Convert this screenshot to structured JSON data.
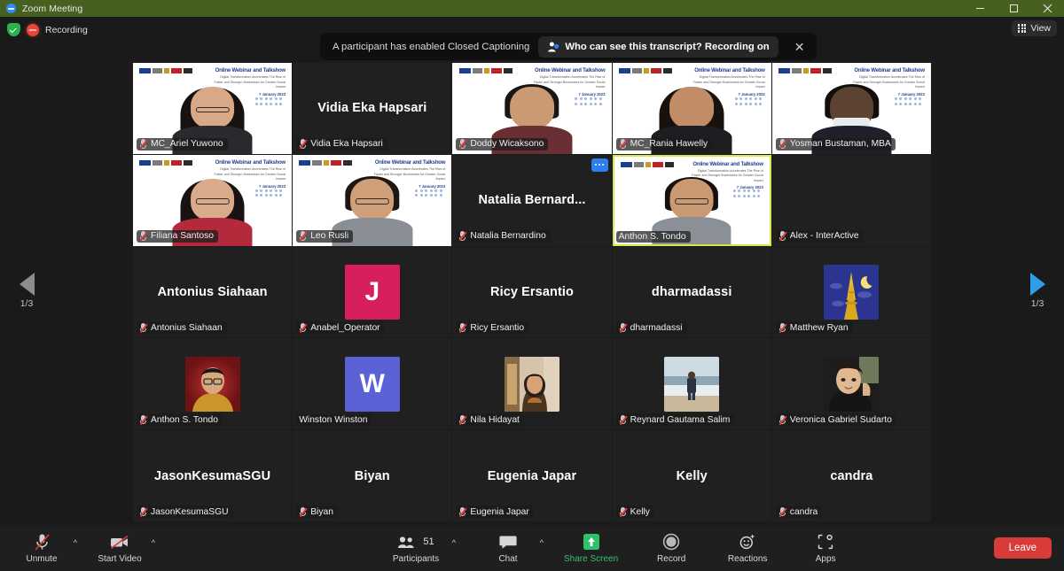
{
  "window": {
    "title": "Zoom Meeting",
    "minimize_label": "minimize",
    "maximize_label": "maximize",
    "close_label": "close"
  },
  "topbar": {
    "recording_label": "Recording",
    "view_label": "View"
  },
  "notification": {
    "message": "A participant has enabled Closed Captioning",
    "action": "Who can see this transcript? Recording on",
    "close": "✕"
  },
  "pagination": {
    "left_page": "1/3",
    "right_page": "1/3"
  },
  "participants": [
    {
      "label": "MC_Ariel Yuwono",
      "display": "",
      "muted": true,
      "kind": "video",
      "skin": "#d8a887",
      "hair": "#17120f",
      "shirt": "#2a2a2e",
      "hairstyle": "long",
      "glasses": true
    },
    {
      "label": "Vidia Eka Hapsari",
      "display": "Vidia Eka Hapsari",
      "muted": true,
      "kind": "name"
    },
    {
      "label": "Doddy Wicaksono",
      "display": "",
      "muted": true,
      "kind": "video",
      "skin": "#c99a73",
      "hair": "#1b1613",
      "shirt": "#6a2f33",
      "hairstyle": "short",
      "glasses": false
    },
    {
      "label": "MC_Rania Hawelly",
      "display": "",
      "muted": true,
      "kind": "video",
      "skin": "#c08d66",
      "hair": "#18120e",
      "shirt": "#1d1d22",
      "hairstyle": "long",
      "glasses": false
    },
    {
      "label": "Yosman Bustaman, MBA",
      "display": "",
      "muted": true,
      "kind": "video",
      "skin": "#5c4231",
      "hair": "#120e0b",
      "shirt": "#20202a",
      "hairstyle": "short",
      "glasses": false,
      "mask": true
    },
    {
      "label": "Filiana Santoso",
      "display": "",
      "muted": true,
      "kind": "video",
      "skin": "#d9ab8a",
      "hair": "#181211",
      "shirt": "#b32a3c",
      "hairstyle": "long",
      "glasses": true
    },
    {
      "label": "Leo Rusli",
      "display": "",
      "muted": true,
      "kind": "video",
      "skin": "#cf9f79",
      "hair": "#1d1714",
      "shirt": "#8a8f96",
      "hairstyle": "short",
      "glasses": true
    },
    {
      "label": "Natalia Bernardino",
      "display": "Natalia  Bernard...",
      "muted": true,
      "kind": "name",
      "more": true
    },
    {
      "label": "Anthon S. Tondo",
      "display": "",
      "muted": false,
      "kind": "video",
      "active": true,
      "skin": "#c99a72",
      "hair": "#151010",
      "shirt": "#8a8f98",
      "hairstyle": "short",
      "glasses": true
    },
    {
      "label": "Alex - InterActive",
      "display": "",
      "muted": true,
      "kind": "blank"
    },
    {
      "label": "Antonius Siahaan",
      "display": "Antonius Siahaan",
      "muted": true,
      "kind": "name"
    },
    {
      "label": "Anabel_Operator",
      "display": "",
      "muted": true,
      "kind": "initial",
      "initial": "J",
      "color": "#d61f5c"
    },
    {
      "label": "Ricy Ersantio",
      "display": "Ricy Ersantio",
      "muted": true,
      "kind": "name"
    },
    {
      "label": "dharmadassi",
      "display": "dharmadassi",
      "muted": true,
      "kind": "name"
    },
    {
      "label": "Matthew Ryan",
      "display": "",
      "muted": true,
      "kind": "photo",
      "photo": "eiffel"
    },
    {
      "label": "Anthon S. Tondo",
      "display": "",
      "muted": true,
      "kind": "photo",
      "photo": "portrait-red"
    },
    {
      "label": "Winston Winston",
      "display": "",
      "muted": false,
      "kind": "initial",
      "initial": "W",
      "color": "#5a62d6"
    },
    {
      "label": "Nila Hidayat",
      "display": "",
      "muted": true,
      "kind": "photo",
      "photo": "hijab"
    },
    {
      "label": "Reynard Gautama Salim",
      "display": "",
      "muted": true,
      "kind": "photo",
      "photo": "beach"
    },
    {
      "label": "Veronica Gabriel Sudarto",
      "display": "",
      "muted": true,
      "kind": "photo",
      "photo": "selfie"
    },
    {
      "label": "JasonKesumaSGU",
      "display": "JasonKesumaSGU",
      "muted": true,
      "kind": "name"
    },
    {
      "label": "Biyan",
      "display": "Biyan",
      "muted": true,
      "kind": "name"
    },
    {
      "label": "Eugenia Japar",
      "display": "Eugenia Japar",
      "muted": true,
      "kind": "name"
    },
    {
      "label": "Kelly",
      "display": "Kelly",
      "muted": true,
      "kind": "name"
    },
    {
      "label": "candra",
      "display": "candra",
      "muted": true,
      "kind": "name"
    }
  ],
  "webinar_background": {
    "title": "Online Webinar and Talkshow",
    "subtitle": "Digital Transformation Accelerates The Rise of Faster and Stronger Businesses for Greater Social Impact",
    "date": "7 January 2023"
  },
  "toolbar": {
    "unmute_label": "Unmute",
    "start_video_label": "Start Video",
    "participants_label": "Participants",
    "participants_count": "51",
    "chat_label": "Chat",
    "share_screen_label": "Share Screen",
    "record_label": "Record",
    "reactions_label": "Reactions",
    "apps_label": "Apps",
    "leave_label": "Leave"
  },
  "colors": {
    "titlebar": "#46611f",
    "share_screen": "#39c06c",
    "leave": "#d93b3b",
    "active_speaker": "#d9e64a",
    "next_page_arrow": "#2d9fe8"
  }
}
